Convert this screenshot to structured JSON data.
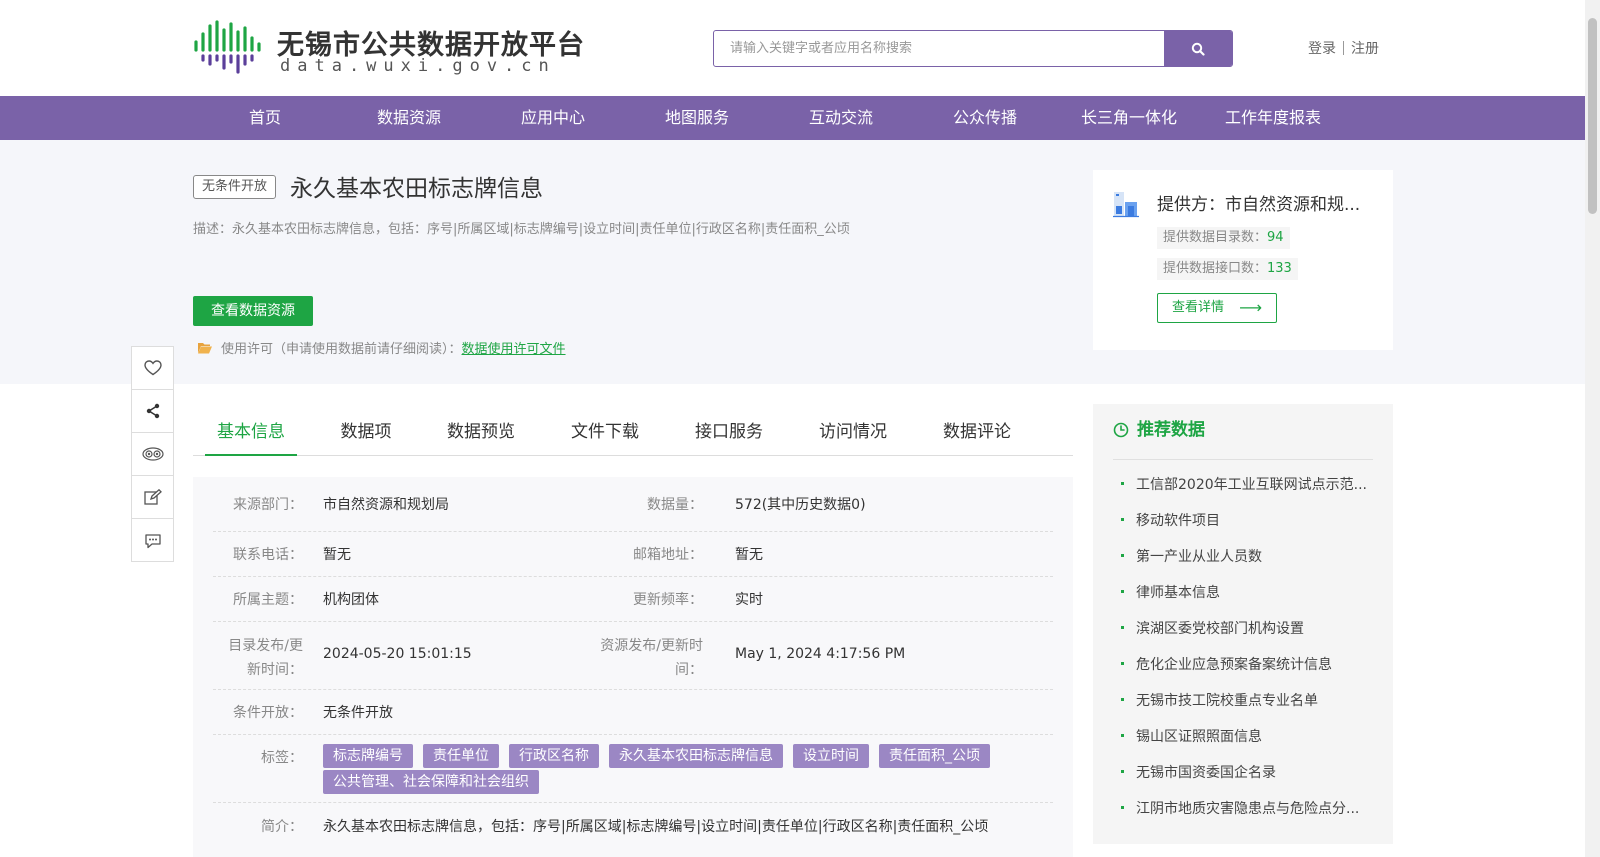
{
  "header": {
    "logo_title": "无锡市公共数据开放平台",
    "logo_sub": "data.wuxi.gov.cn",
    "search_placeholder": "请输入关键字或者应用名称搜索",
    "login": "登录",
    "register": "注册"
  },
  "nav": [
    "首页",
    "数据资源",
    "应用中心",
    "地图服务",
    "互动交流",
    "公众传播",
    "长三角一体化",
    "工作年度报表"
  ],
  "dataset": {
    "open_tag": "无条件开放",
    "title": "永久基本农田标志牌信息",
    "description": "描述：永久基本农田标志牌信息，包括：序号|所属区域|标志牌编号|设立时间|责任单位|行政区名称|责任面积_公顷",
    "view_button": "查看数据资源",
    "license_text": "使用许可（申请使用数据前请仔细阅读）：",
    "license_link": "数据使用许可文件"
  },
  "provider": {
    "name": "提供方：市自然资源和规...",
    "catalog_label": "提供数据目录数：",
    "catalog_count": "94",
    "api_label": "提供数据接口数：",
    "api_count": "133",
    "detail_button": "查看详情"
  },
  "side_toolbar": [
    "heart-icon",
    "share-icon",
    "view-icon",
    "edit-icon",
    "comment-icon"
  ],
  "tabs": [
    "基本信息",
    "数据项",
    "数据预览",
    "文件下载",
    "接口服务",
    "访问情况",
    "数据评论"
  ],
  "info": {
    "source_dept_label": "来源部门：",
    "source_dept": "市自然资源和规划局",
    "data_volume_label": "数据量：",
    "data_volume": "572(其中历史数据0)",
    "phone_label": "联系电话：",
    "phone": "暂无",
    "email_label": "邮箱地址：",
    "email": "暂无",
    "theme_label": "所属主题：",
    "theme": "机构团体",
    "freq_label": "更新频率：",
    "freq": "实时",
    "catalog_time_label_1": "目录发布/更",
    "catalog_time_label_2": "新时间：",
    "catalog_time": "2024-05-20 15:01:15",
    "resource_time_label_1": "资源发布/更新时",
    "resource_time_label_2": "间：",
    "resource_time": "May 1, 2024 4:17:56 PM",
    "condition_label": "条件开放：",
    "condition": "无条件开放",
    "tags_label": "标签：",
    "tags": [
      "标志牌编号",
      "责任单位",
      "行政区名称",
      "永久基本农田标志牌信息",
      "设立时间",
      "责任面积_公顷",
      "公共管理、社会保障和社会组织"
    ],
    "intro_label": "简介：",
    "intro": "永久基本农田标志牌信息，包括：序号|所属区域|标志牌编号|设立时间|责任单位|行政区名称|责任面积_公顷"
  },
  "recommend": {
    "title": "推荐数据",
    "items": [
      "工信部2020年工业互联网试点示范...",
      "移动软件项目",
      "第一产业从业人员数",
      "律师基本信息",
      "滨湖区委党校部门机构设置",
      "危化企业应急预案备案统计信息",
      "无锡市技工院校重点专业名单",
      "锡山区证照照面信息",
      "无锡市国资委国企名录",
      "江阴市地质灾害隐患点与危险点分..."
    ]
  },
  "colors": {
    "brand_purple": "#7a62a8",
    "accent_green": "#1ea544",
    "tag_purple": "#9b87c4"
  }
}
